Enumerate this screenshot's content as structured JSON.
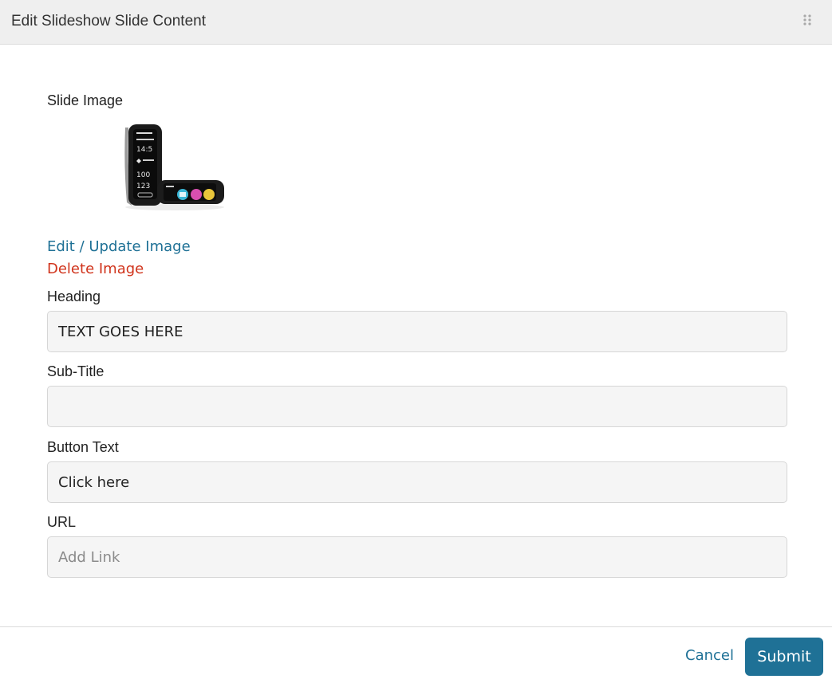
{
  "modal": {
    "title": "Edit Slideshow Slide Content"
  },
  "slide_image": {
    "label": "Slide Image",
    "edit_link": "Edit / Update Image",
    "delete_link": "Delete Image"
  },
  "fields": {
    "heading": {
      "label": "Heading",
      "value": "TEXT GOES HERE",
      "placeholder": ""
    },
    "subtitle": {
      "label": "Sub-Title",
      "value": "",
      "placeholder": ""
    },
    "button_text": {
      "label": "Button Text",
      "value": "Click here",
      "placeholder": ""
    },
    "url": {
      "label": "URL",
      "value": "",
      "placeholder": "Add Link"
    }
  },
  "footer": {
    "cancel_label": "Cancel",
    "submit_label": "Submit"
  },
  "colors": {
    "accent": "#1f7196",
    "danger": "#d0331b",
    "header_bg": "#efefef",
    "input_bg": "#f5f5f5"
  },
  "icons": {
    "drag_handle": "drag-handle-icon",
    "thumbnail": "fitness-tracker-image"
  }
}
